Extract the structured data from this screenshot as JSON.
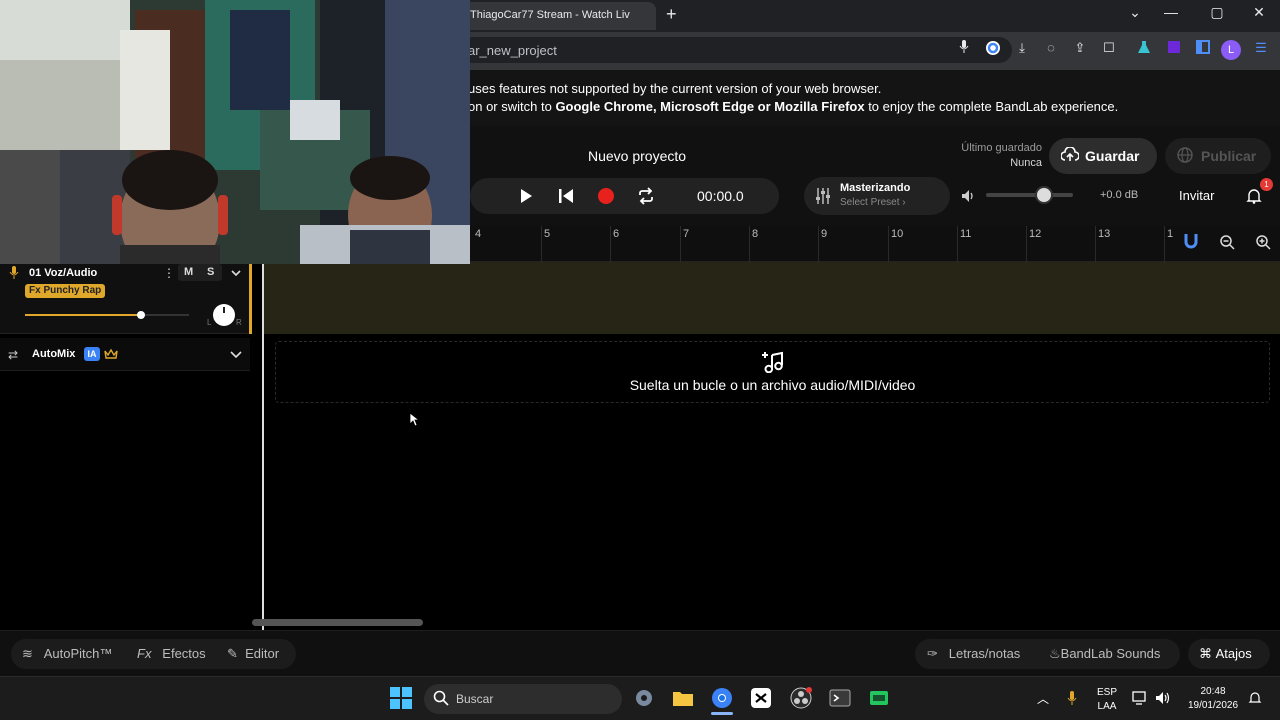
{
  "browser": {
    "tab_title": "ThiagoCar77 Stream - Watch Liv",
    "url": "ar_new_project",
    "profile_initial": "L"
  },
  "banner": {
    "line1": "uses features not supported by the current version of your web browser.",
    "line2_pre": "on or switch to ",
    "line2_browsers": "Google Chrome, Microsoft Edge or Mozilla Firefox",
    "line2_post": " to enjoy the complete BandLab experience."
  },
  "header": {
    "project_title": "Nuevo proyecto",
    "last_saved_label": "Último guardado",
    "last_saved_value": "Nunca",
    "save_label": "Guardar",
    "publish_label": "Publicar",
    "time": "00:00.0",
    "mastering_label": "Masterizando",
    "preset_label": "Select Preset",
    "volume_db": "+0.0 dB",
    "invite_label": "Invitar",
    "notification_count": "1"
  },
  "ruler": {
    "ticks": [
      "4",
      "5",
      "6",
      "7",
      "8",
      "9",
      "10",
      "11",
      "12",
      "13",
      "1"
    ]
  },
  "track": {
    "number_name": "01  Voz/Audio",
    "fx": "Fx Punchy Rap",
    "mute": "M",
    "solo": "S",
    "volume_fraction": 0.7,
    "pan_left": "L",
    "pan_right": "R"
  },
  "automix": {
    "label": "AutoMix",
    "badge": "IA"
  },
  "dropzone": {
    "text": "Suelta un bucle o un archivo audio/MIDI/video"
  },
  "bottom_bar": {
    "autopitch": "AutoPitch™",
    "effects": "Efectos",
    "effects_prefix": "Fx",
    "editor": "Editor",
    "lyrics": "Letras/notas",
    "sounds": "BandLab Sounds",
    "shortcuts": "Atajos"
  },
  "taskbar": {
    "search_placeholder": "Buscar",
    "lang1": "ESP",
    "lang2": "LAA",
    "time": "20:48",
    "date": "19/01/2026"
  },
  "colors": {
    "accent": "#e0a82a",
    "record": "#e8211d",
    "ia_badge": "#3b82f6"
  }
}
